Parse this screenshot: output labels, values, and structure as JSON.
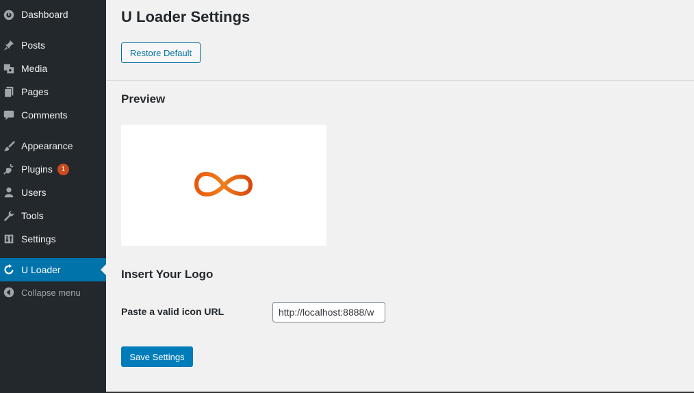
{
  "sidebar": {
    "items": [
      {
        "label": "Dashboard",
        "icon": "dashboard-icon"
      },
      {
        "label": "Posts",
        "icon": "pin-icon"
      },
      {
        "label": "Media",
        "icon": "media-icon"
      },
      {
        "label": "Pages",
        "icon": "pages-icon"
      },
      {
        "label": "Comments",
        "icon": "comment-icon"
      },
      {
        "label": "Appearance",
        "icon": "brush-icon"
      },
      {
        "label": "Plugins",
        "icon": "plugin-icon",
        "badge": "1"
      },
      {
        "label": "Users",
        "icon": "user-icon"
      },
      {
        "label": "Tools",
        "icon": "wrench-icon"
      },
      {
        "label": "Settings",
        "icon": "sliders-icon"
      },
      {
        "label": "U Loader",
        "icon": "reload-icon",
        "active": true
      },
      {
        "label": "Collapse menu",
        "icon": "collapse-arrow-icon"
      }
    ]
  },
  "main": {
    "title": "U Loader Settings",
    "restore_label": "Restore Default",
    "preview_heading": "Preview",
    "preview_icon": "infinity-loader-icon",
    "logo_heading": "Insert Your Logo",
    "url_label": "Paste a valid icon URL",
    "url_value": "http://localhost:8888/w",
    "save_label": "Save Settings"
  },
  "colors": {
    "sidebar_bg": "#23282d",
    "active_bg": "#0073aa",
    "primary_button": "#007cba",
    "badge": "#ca4a1f",
    "loader_orange": "#e8590c"
  }
}
